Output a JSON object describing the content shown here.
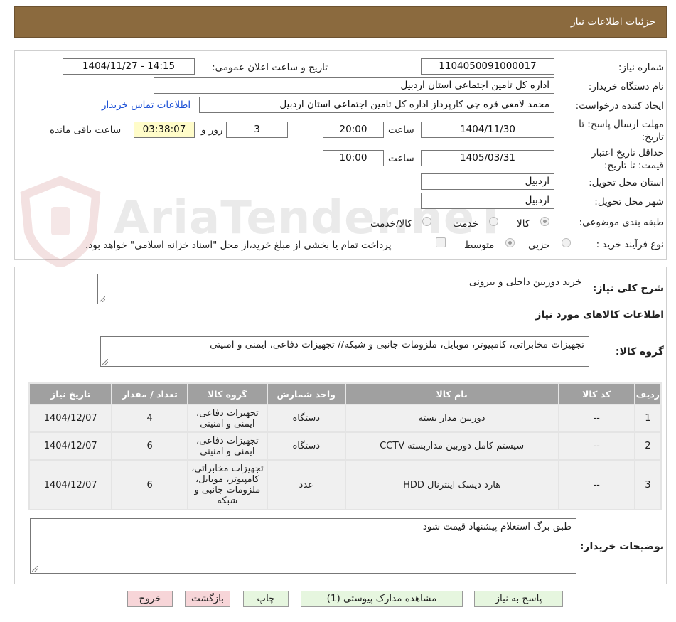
{
  "header": {
    "title": "جزئیات اطلاعات نیاز"
  },
  "watermark": {
    "text": "AriaTender.neT"
  },
  "info": {
    "need_number_label": "شماره نیاز:",
    "need_number": "1104050091000017",
    "announce_label": "تاریخ و ساعت اعلان عمومی:",
    "announce_value": "1404/11/27 - 14:15",
    "buyer_label": "نام دستگاه خریدار:",
    "buyer_value": "اداره کل تامین اجتماعی استان اردبیل",
    "creator_label": "ایجاد کننده درخواست:",
    "creator_value": "محمد لامعی قره چی کارپرداز اداره کل تامین اجتماعی استان اردبیل",
    "contact_link": "اطلاعات تماس خریدار",
    "deadline_label": "مهلت ارسال پاسخ: تا تاریخ:",
    "deadline_date": "1404/11/30",
    "time_label": "ساعت",
    "deadline_time": "20:00",
    "days_value": "3",
    "days_label": "روز و",
    "remaining_time": "03:38:07",
    "remaining_label": "ساعت باقی مانده",
    "validity_label": "حداقل تاریخ اعتبار قیمت: تا تاریخ:",
    "validity_date": "1405/03/31",
    "validity_time": "10:00",
    "province_label": "استان محل تحویل:",
    "province_value": "اردبیل",
    "city_label": "شهر محل تحویل:",
    "city_value": "اردبیل",
    "category_label": "طبقه بندی موضوعی:",
    "category_options": [
      "کالا",
      "خدمت",
      "کالا/خدمت"
    ],
    "category_selected": "کالا",
    "process_label": "نوع فرآیند خرید :",
    "process_options": [
      "جزیی",
      "متوسط"
    ],
    "process_selected": "متوسط",
    "payment_note": "پرداخت تمام یا بخشی از مبلغ خرید،از محل \"اسناد خزانه اسلامی\" خواهد بود."
  },
  "summary": {
    "general_label": "شرح کلی نیاز:",
    "general_value": "خرید دوربین داخلی و بیرونی",
    "goods_info_title": "اطلاعات کالاهای مورد نیاز",
    "group_label": "گروه کالا:",
    "group_value": "تجهیزات مخابراتی، کامپیوتر، موبایل، ملزومات جانبی و شبکه// تجهیزات دفاعی، ایمنی و امنیتی"
  },
  "table": {
    "headers": [
      "ردیف",
      "کد کالا",
      "نام کالا",
      "واحد شمارش",
      "گروه کالا",
      "تعداد / مقدار",
      "تاریخ نیاز"
    ],
    "rows": [
      {
        "idx": "1",
        "code": "--",
        "name": "دوربین مدار بسته",
        "unit": "دستگاه",
        "group": "تجهیزات دفاعی، ایمنی و امنیتی",
        "qty": "4",
        "date": "1404/12/07"
      },
      {
        "idx": "2",
        "code": "--",
        "name": "سیستم کامل دوربین مداربسته CCTV",
        "unit": "دستگاه",
        "group": "تجهیزات دفاعی، ایمنی و امنیتی",
        "qty": "6",
        "date": "1404/12/07"
      },
      {
        "idx": "3",
        "code": "--",
        "name": "هارد دیسک اینترنال HDD",
        "unit": "عدد",
        "group": "تجهیزات مخابراتی، کامپیوتر، موبایل، ملزومات جانبی و شبکه",
        "qty": "6",
        "date": "1404/12/07"
      }
    ]
  },
  "buyer_notes": {
    "label": "توضیحات خریدار:",
    "value": "طبق برگ استعلام پیشنهاد قیمت شود"
  },
  "buttons": {
    "reply": "پاسخ به نیاز",
    "attachments": "مشاهده مدارک پیوستی (1)",
    "print": "چاپ",
    "back": "بازگشت",
    "exit": "خروج"
  }
}
